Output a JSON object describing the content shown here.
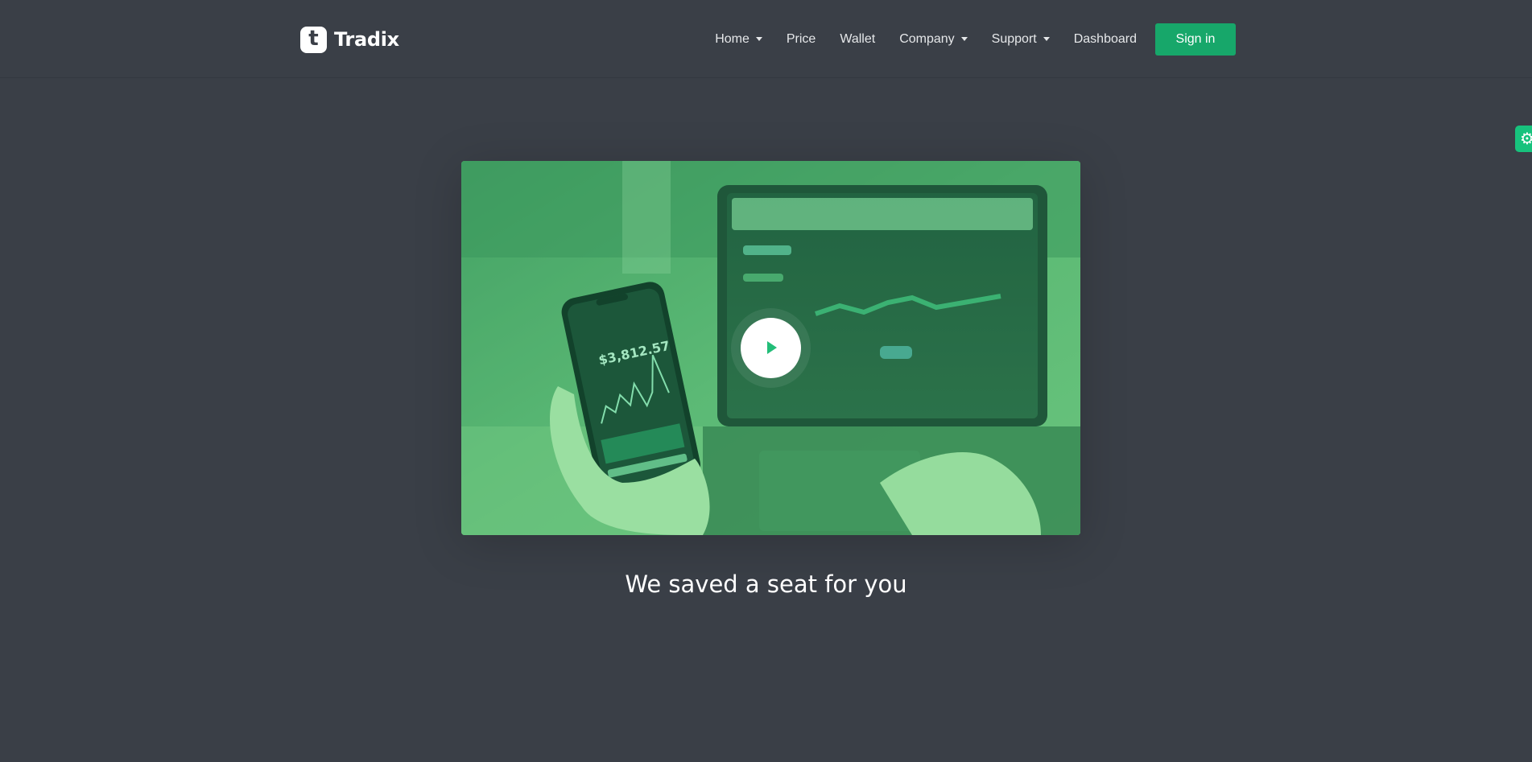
{
  "brand": {
    "mark_letter": "t",
    "name": "Tradix"
  },
  "nav": {
    "items": [
      {
        "label": "Home",
        "dropdown": true
      },
      {
        "label": "Price",
        "dropdown": false
      },
      {
        "label": "Wallet",
        "dropdown": false
      },
      {
        "label": "Company",
        "dropdown": true
      },
      {
        "label": "Support",
        "dropdown": true
      },
      {
        "label": "Dashboard",
        "dropdown": false
      }
    ],
    "signin_label": "Sign in"
  },
  "video": {
    "phone_price": "$3,812.57",
    "play_icon": "play-icon"
  },
  "settings": {
    "icon": "gear-icon"
  },
  "headline": "We saved a seat for you",
  "colors": {
    "background": "#3a3f47",
    "accent": "#17a76a",
    "overlay": "#22bd78"
  }
}
